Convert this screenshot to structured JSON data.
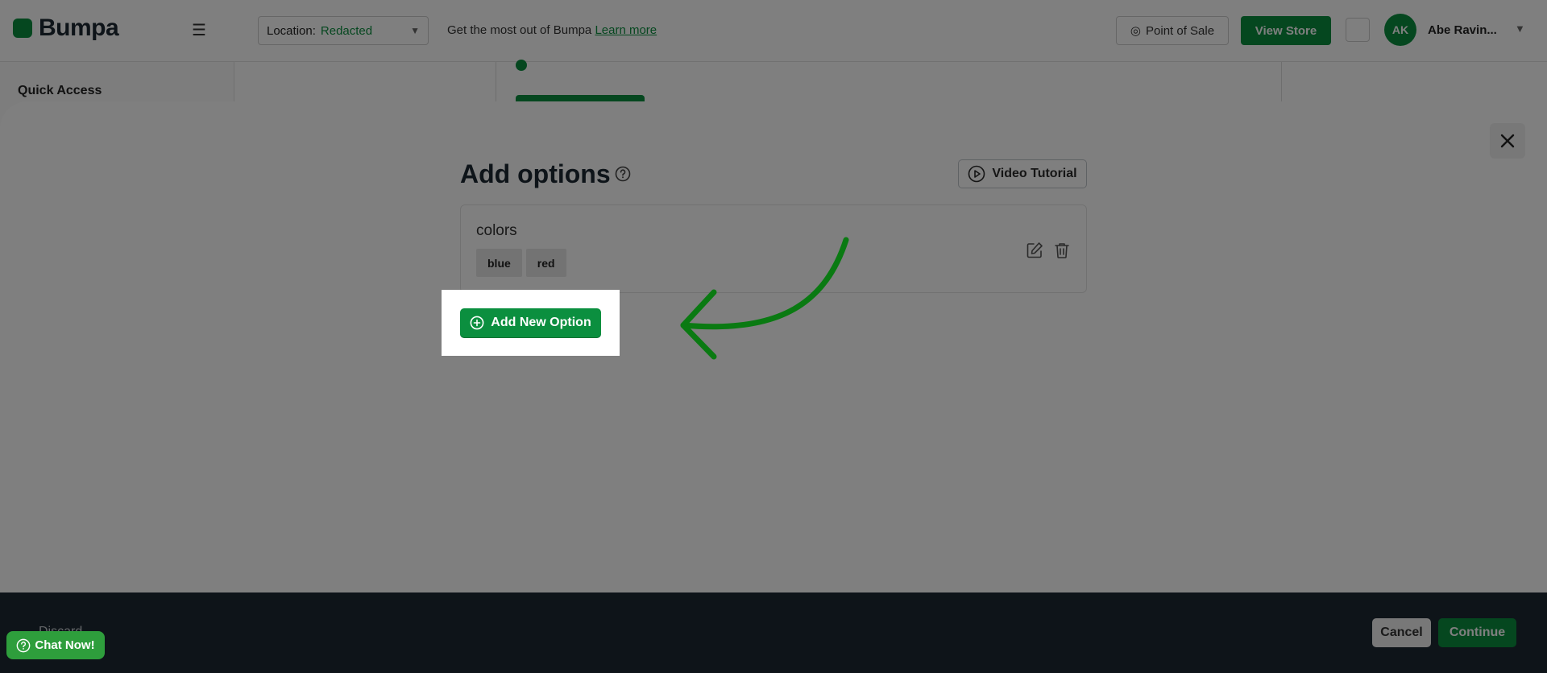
{
  "app": {
    "brand": "Bumpa"
  },
  "header": {
    "location_label": "Location:",
    "location_value": "Redacted",
    "promo_text": "Get the most out of Bumpa",
    "promo_link": "Learn more",
    "pos_label": "Point of Sale",
    "view_store_label": "View Store",
    "user_initials": "AK",
    "user_name": "Abe Ravin..."
  },
  "sidebar": {
    "quick_access": "Quick Access"
  },
  "modal": {
    "title": "Add options",
    "video_tutorial_label": "Video Tutorial",
    "option": {
      "name": "colors",
      "values": [
        "blue",
        "red"
      ]
    },
    "add_option_label": "Add New Option"
  },
  "footer": {
    "left_text": "Discard",
    "cancel_label": "Cancel",
    "continue_label": "Continue"
  },
  "chat": {
    "label": "Chat Now!"
  },
  "colors": {
    "accent": "#0b8f3f",
    "footer": "#1c2833",
    "pointer_arrow": "#0a7a12"
  }
}
